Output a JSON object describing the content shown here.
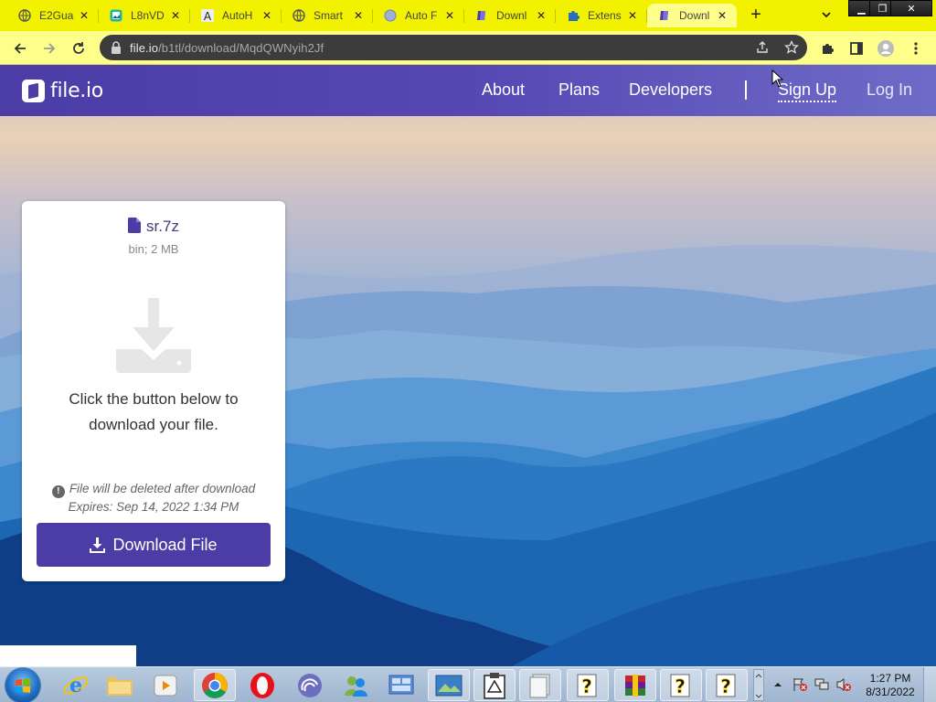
{
  "browser": {
    "tabs": [
      {
        "title": "E2Gua",
        "icon": "globe-icon",
        "active": false
      },
      {
        "title": "L8nVD",
        "icon": "image-app-icon",
        "active": false
      },
      {
        "title": "AutoH",
        "icon": "letter-a-icon",
        "active": false
      },
      {
        "title": "Smart",
        "icon": "globe-icon",
        "active": false
      },
      {
        "title": "Auto F",
        "icon": "circle-app-icon",
        "active": false
      },
      {
        "title": "Downl",
        "icon": "fileio-icon",
        "active": false
      },
      {
        "title": "Extens",
        "icon": "puzzle-icon",
        "active": false
      },
      {
        "title": "Downl",
        "icon": "fileio-icon",
        "active": true
      }
    ],
    "address": {
      "host": "file.io",
      "path": "/b1tl/download/MqdQWNyih2Jf"
    }
  },
  "site": {
    "logo_text": "file.io",
    "nav": {
      "about": "About",
      "plans": "Plans",
      "developers": "Developers",
      "signup": "Sign Up",
      "login": "Log In"
    }
  },
  "card": {
    "file_name": "sr.7z",
    "file_meta": "bin; 2 MB",
    "message": "Click the button below to download your file.",
    "warning": "File will be deleted after download",
    "expires": "Expires: Sep 14, 2022 1:34 PM",
    "download_label": "Download File"
  },
  "taskbar": {
    "clock_time": "1:27 PM",
    "clock_date": "8/31/2022"
  },
  "colors": {
    "brand": "#4b3ca6",
    "tabstrip": "#f2f200",
    "toolbar": "#fefe8a"
  }
}
